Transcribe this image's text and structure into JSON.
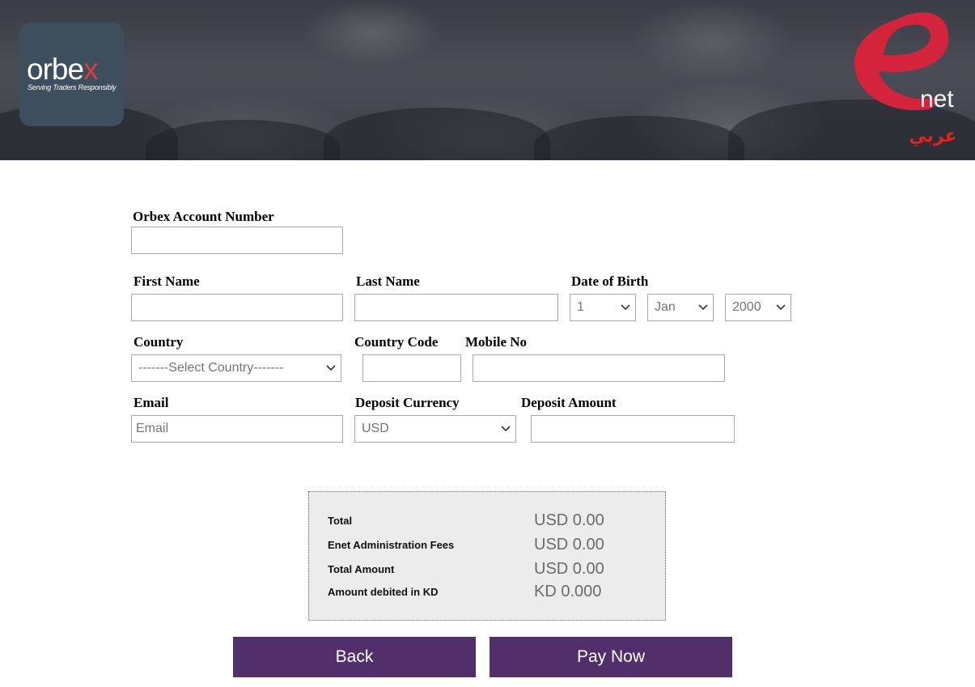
{
  "header": {
    "orbex_logo_text": "orbex",
    "orbex_tagline": "Serving Traders Responsibly",
    "enet_logo_text": "net",
    "language_link": "عربي"
  },
  "form": {
    "account_number": {
      "label": "Orbex Account Number",
      "value": ""
    },
    "first_name": {
      "label": "First Name",
      "value": ""
    },
    "last_name": {
      "label": "Last Name",
      "value": ""
    },
    "date_of_birth": {
      "label": "Date of Birth",
      "day": "1",
      "month": "Jan",
      "year": "2000"
    },
    "country": {
      "label": "Country",
      "selected": "-------Select Country-------"
    },
    "country_code": {
      "label": "Country Code",
      "value": ""
    },
    "mobile_no": {
      "label": "Mobile No",
      "value": ""
    },
    "email": {
      "label": "Email",
      "placeholder": "Email"
    },
    "deposit_currency": {
      "label": "Deposit Currency",
      "selected": "USD"
    },
    "deposit_amount": {
      "label": "Deposit Amount",
      "value": ""
    }
  },
  "summary": {
    "rows": [
      {
        "label": "Total",
        "value": "USD 0.00"
      },
      {
        "label": "Enet Administration Fees",
        "value": "USD 0.00"
      },
      {
        "label": "Total Amount",
        "value": "USD 0.00"
      },
      {
        "label": "Amount debited in KD",
        "value": "KD 0.000"
      }
    ]
  },
  "actions": {
    "back_label": "Back",
    "pay_label": "Pay Now"
  },
  "colors": {
    "button_bg": "#502f6b",
    "enet_red": "#d3243c",
    "arabic_link": "#e81f1f",
    "summary_bg": "#ececec"
  }
}
